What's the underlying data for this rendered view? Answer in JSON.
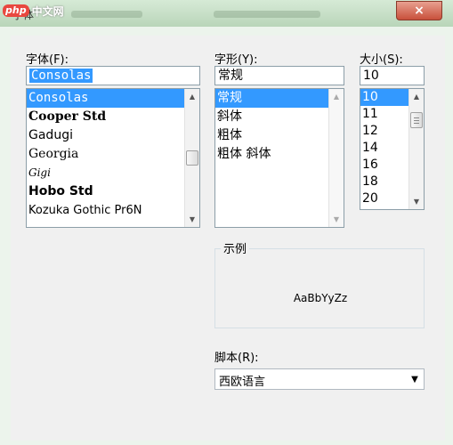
{
  "watermark": {
    "logo": "php",
    "text": "中文网"
  },
  "window": {
    "title": "字体",
    "close_symbol": "×"
  },
  "font": {
    "label": "字体(F):",
    "value": "Consolas",
    "items": [
      "Consolas",
      "Cooper Std",
      "Gadugi",
      "Georgia",
      "Gigi",
      "Hobo Std",
      "Kozuka Gothic Pr6N"
    ],
    "selected_index": 0
  },
  "style": {
    "label": "字形(Y):",
    "value": "常规",
    "items": [
      "常规",
      "斜体",
      "粗体",
      "粗体 斜体"
    ],
    "selected_index": 0
  },
  "size": {
    "label": "大小(S):",
    "value": "10",
    "items": [
      "10",
      "11",
      "12",
      "14",
      "16",
      "18",
      "20"
    ],
    "selected_index": 0
  },
  "sample": {
    "legend": "示例",
    "text": "AaBbYyZz"
  },
  "script": {
    "label": "脚本(R):",
    "value": "西欧语言"
  },
  "colors": {
    "selection": "#3399ff",
    "titlebar": "#c6dfc6",
    "dialog": "#f0f0f0"
  },
  "scroll_arrows": {
    "up": "▲",
    "down": "▼"
  }
}
